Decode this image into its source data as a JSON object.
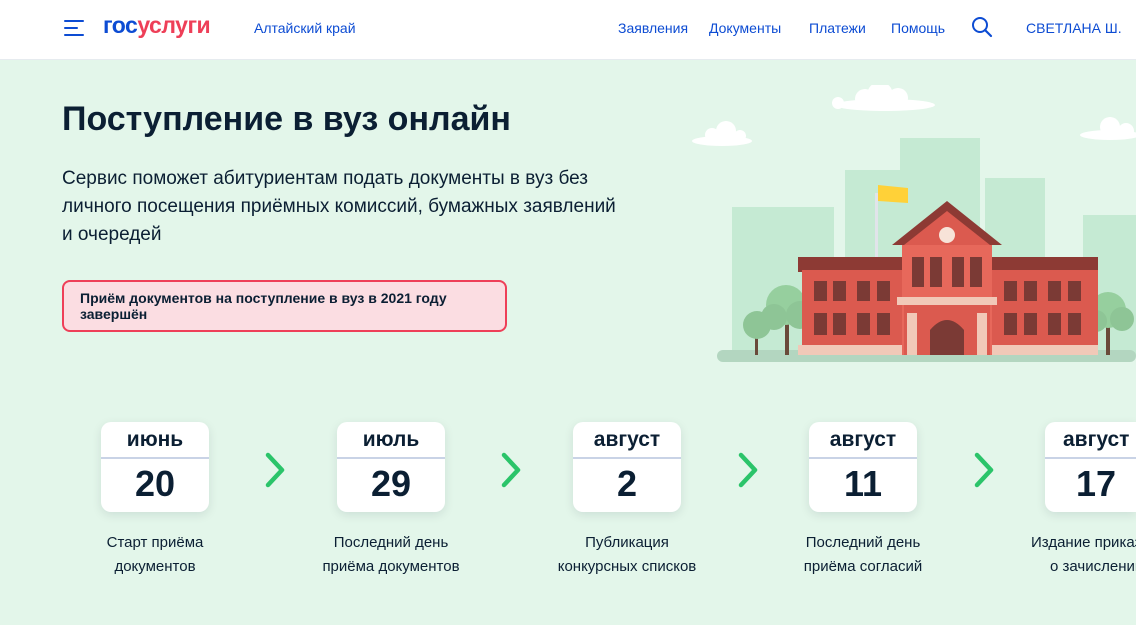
{
  "header": {
    "logo_part1": "гос",
    "logo_part2": "услуги",
    "region": "Алтайский край",
    "nav": [
      "Заявления",
      "Документы",
      "Платежи",
      "Помощь"
    ],
    "search_icon": "search-icon",
    "user_name": "СВЕТЛАНА Ш."
  },
  "hero": {
    "title": "Поступление в вуз онлайн",
    "description": "Сервис поможет абитуриентам подать документы в вуз без личного посещения приёмных комиссий, бумажных заявлений и очередей",
    "alert": "Приём документов на поступление в вуз в 2021 году завершён"
  },
  "timeline": [
    {
      "month": "июнь",
      "day": "20",
      "caption_line1": "Старт приёма",
      "caption_line2": "документов"
    },
    {
      "month": "июль",
      "day": "29",
      "caption_line1": "Последний день",
      "caption_line2": "приёма документов"
    },
    {
      "month": "август",
      "day": "2",
      "caption_line1": "Публикация",
      "caption_line2": "конкурсных списков"
    },
    {
      "month": "август",
      "day": "11",
      "caption_line1": "Последний день",
      "caption_line2": "приёма согласий"
    },
    {
      "month": "август",
      "day": "17",
      "caption_line1": "Издание приказа",
      "caption_line2": "о зачислении"
    }
  ],
  "colors": {
    "brand_blue": "#0d4cd3",
    "brand_red": "#ee3f58",
    "background_green": "#e3f6ea",
    "chevron_green": "#2bc46a"
  }
}
